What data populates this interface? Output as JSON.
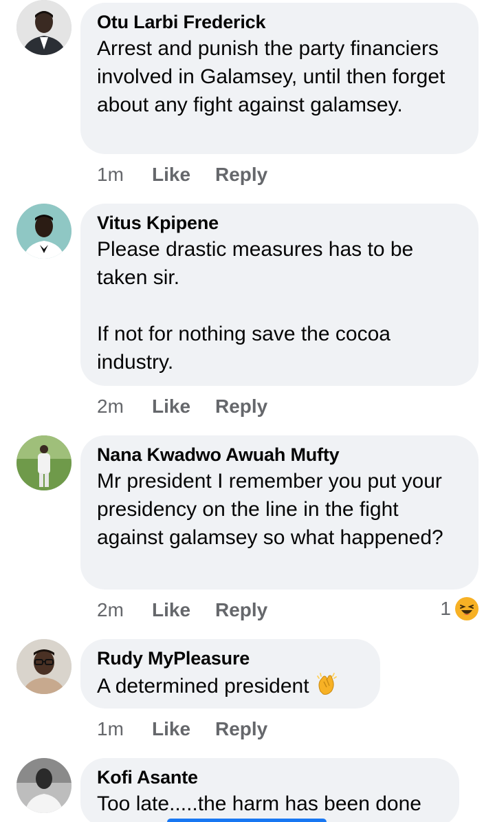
{
  "comments": [
    {
      "author": "Otu Larbi Frederick",
      "text": "Arrest and punish the party financiers involved in Galamsey, until then forget about any fight against galamsey.",
      "time": "1m",
      "like_label": "Like",
      "reply_label": "Reply"
    },
    {
      "author": "Vitus Kpipene",
      "text": "Please drastic measures has to be taken sir.\n\nIf not for nothing save the cocoa industry.",
      "time": "2m",
      "like_label": "Like",
      "reply_label": "Reply"
    },
    {
      "author": "Nana Kwadwo Awuah Mufty",
      "text": "Mr president I remember you put your presidency on the line in the fight against galamsey so what happened?",
      "time": "2m",
      "like_label": "Like",
      "reply_label": "Reply",
      "reaction_count": "1",
      "reaction_icon": "laughing-emoji"
    },
    {
      "author": "Rudy MyPleasure",
      "text": "A determined president",
      "text_emoji": "clapping-hands-icon",
      "time": "1m",
      "like_label": "Like",
      "reply_label": "Reply"
    },
    {
      "author": "Kofi Asante",
      "text": "Too late.....the harm has been done"
    }
  ],
  "colors": {
    "bubble": "#f0f2f5",
    "meta_text": "#65676b",
    "primary_text": "#050505",
    "accent": "#1877f2"
  }
}
